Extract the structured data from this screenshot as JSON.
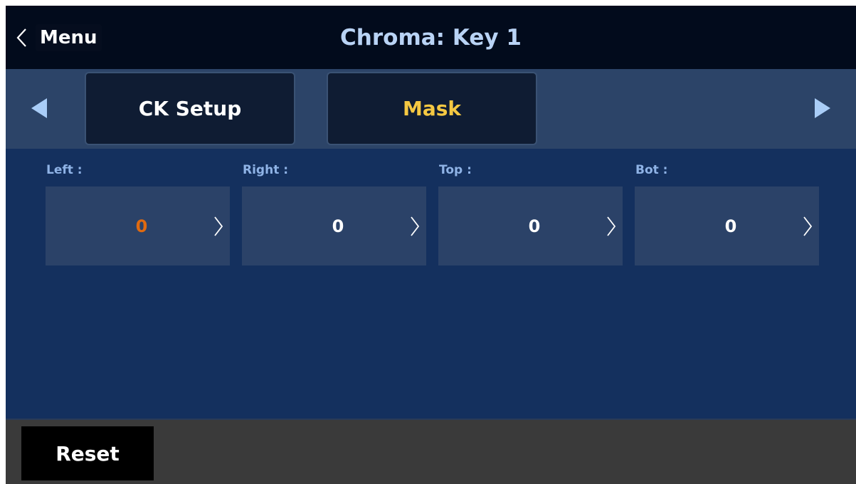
{
  "header": {
    "back_label": "Menu",
    "title": "Chroma: Key 1"
  },
  "tabs": [
    {
      "label": "CK Setup",
      "selected": false
    },
    {
      "label": "Mask",
      "selected": true
    }
  ],
  "fields": [
    {
      "label": "Left :",
      "value": "0",
      "active": true
    },
    {
      "label": "Right :",
      "value": "0",
      "active": false
    },
    {
      "label": "Top :",
      "value": "0",
      "active": false
    },
    {
      "label": "Bot :",
      "value": "0",
      "active": false
    }
  ],
  "footer": {
    "reset_label": "Reset"
  },
  "icons": {
    "back": "chevron-left-icon",
    "prev": "triangle-left-icon",
    "next": "triangle-right-icon",
    "field_arrow": "chevron-right-icon"
  },
  "colors": {
    "title": "#b9d3f5",
    "selected_tab": "#f5c842",
    "active_value": "#e06a10",
    "field_label": "#8fb3e6",
    "background": "#14305e"
  }
}
